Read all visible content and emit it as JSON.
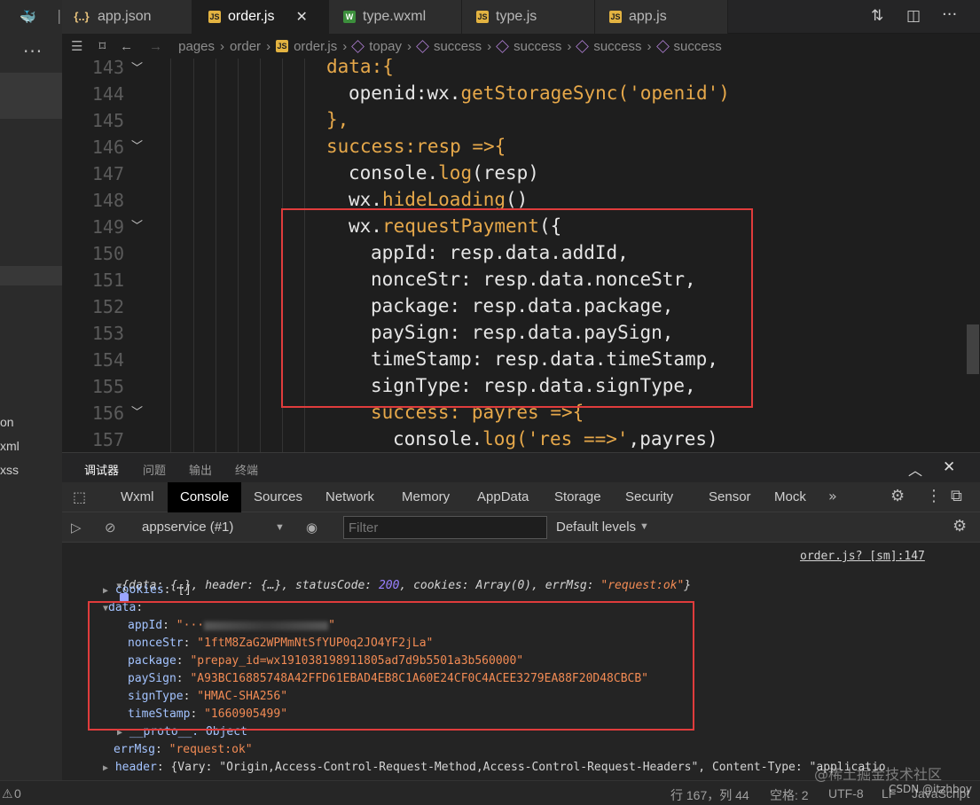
{
  "tabs": [
    {
      "label": "app.json",
      "icon": "{..}",
      "type": "json"
    },
    {
      "label": "order.js",
      "icon": "JS",
      "type": "js",
      "active": true
    },
    {
      "label": "type.wxml",
      "icon": "W",
      "type": "wxml"
    },
    {
      "label": "type.js",
      "icon": "JS",
      "type": "js"
    },
    {
      "label": "app.js",
      "icon": "JS",
      "type": "js"
    }
  ],
  "sidebar": {
    "fragments": [
      "on",
      "xml",
      "xss"
    ],
    "more": "···"
  },
  "breadcrumb": [
    "pages",
    "order",
    "order.js",
    "topay",
    "success",
    "success",
    "success",
    "success"
  ],
  "editor": {
    "lines": [
      {
        "n": "143",
        "fold": true
      },
      {
        "n": "144",
        "fold": false
      },
      {
        "n": "145",
        "fold": false
      },
      {
        "n": "146",
        "fold": true
      },
      {
        "n": "147",
        "fold": false
      },
      {
        "n": "148",
        "fold": false
      },
      {
        "n": "149",
        "fold": true
      },
      {
        "n": "150",
        "fold": false
      },
      {
        "n": "151",
        "fold": false
      },
      {
        "n": "152",
        "fold": false
      },
      {
        "n": "153",
        "fold": false
      },
      {
        "n": "154",
        "fold": false
      },
      {
        "n": "155",
        "fold": false
      },
      {
        "n": "156",
        "fold": true
      },
      {
        "n": "157",
        "fold": false
      }
    ],
    "code": {
      "l143a": "data",
      "l143b": ":{",
      "l144a": "openid",
      "l144b": ":wx.",
      "l144c": "getStorageSync",
      "l144d": "(",
      "l144e": "'openid'",
      "l144f": ")",
      "l145": "},",
      "l146a": "success",
      "l146b": ":",
      "l146c": "resp",
      "l146d": " =>{",
      "l147a": "console.",
      "l147b": "log",
      "l147c": "(resp)",
      "l148a": "wx.",
      "l148b": "hideLoading",
      "l148c": "()",
      "l149a": "wx.",
      "l149b": "requestPayment",
      "l149c": "({",
      "l150a": "appId",
      "l150b": ": resp.data.addId,",
      "l151a": "nonceStr",
      "l151b": ": resp.data.nonceStr,",
      "l152a": "package",
      "l152b": ": resp.data.package,",
      "l153a": "paySign",
      "l153b": ": resp.data.paySign,",
      "l154a": "timeStamp",
      "l154b": ": resp.data.timeStamp,",
      "l155a": "signType",
      "l155b": ": resp.data.signType,",
      "l156a": "success",
      "l156b": ": ",
      "l156c": "payres",
      "l156d": " =>{",
      "l157a": "console.",
      "l157b": "log",
      "l157c": "(",
      "l157d": "'res ==>'",
      "l157e": ",payres)"
    }
  },
  "devtools": {
    "top_tabs": [
      "调试器",
      "问题",
      "输出",
      "终端"
    ],
    "panel_tabs": [
      "Wxml",
      "Console",
      "Sources",
      "Network",
      "Memory",
      "AppData",
      "Storage",
      "Security",
      "Sensor",
      "Mock"
    ],
    "context": "appservice (#1)",
    "filter_placeholder": "Filter",
    "levels": "Default levels",
    "source_link": "order.js? [sm]:147"
  },
  "console": {
    "summary": {
      "open": "{data: {…}, header: {…}, statusCode: ",
      "status": "200",
      "mid": ", cookies: Array(0), errMsg: ",
      "errmsg": "\"request:ok\"",
      "close": "}"
    },
    "cookies_key": "cookies",
    "cookies_val": "[]",
    "data_key": "data",
    "fields": [
      {
        "key": "appId",
        "value": "\"···"
      },
      {
        "key": "nonceStr",
        "value": "\"1ftM8ZaG2WPMmNtSfYUP0q2JO4YF2jLa\""
      },
      {
        "key": "package",
        "value": "\"prepay_id=wx191038198911805ad7d9b5501a3b560000\""
      },
      {
        "key": "paySign",
        "value": "\"A93BC16885748A42FFD61EBAD4EB8C1A60E24CF0C4ACEE3279EA88F20D48CBCB\""
      },
      {
        "key": "signType",
        "value": "\"HMAC-SHA256\""
      },
      {
        "key": "timeStamp",
        "value": "\"1660905499\""
      }
    ],
    "proto": "__proto__: Object",
    "errmsg_key": "errMsg",
    "errmsg_val": "\"request:ok\"",
    "header_key": "header",
    "header_val": "{Vary: \"Origin,Access-Control-Request-Method,Access-Control-Request-Headers\", Content-Type: \"applicatio"
  },
  "status": {
    "problems": "0",
    "position": "行 167，列 44",
    "indent": "空格: 2",
    "encoding": "UTF-8",
    "eol": "LF",
    "language": "JavaScript"
  },
  "watermark": {
    "main": "@稀土掘金技术社区",
    "sub": "CSDN @itzhboy"
  },
  "colors": {
    "highlight": "#e03c3c",
    "keyword": "#e6a84a",
    "string_console": "#f28b54"
  }
}
